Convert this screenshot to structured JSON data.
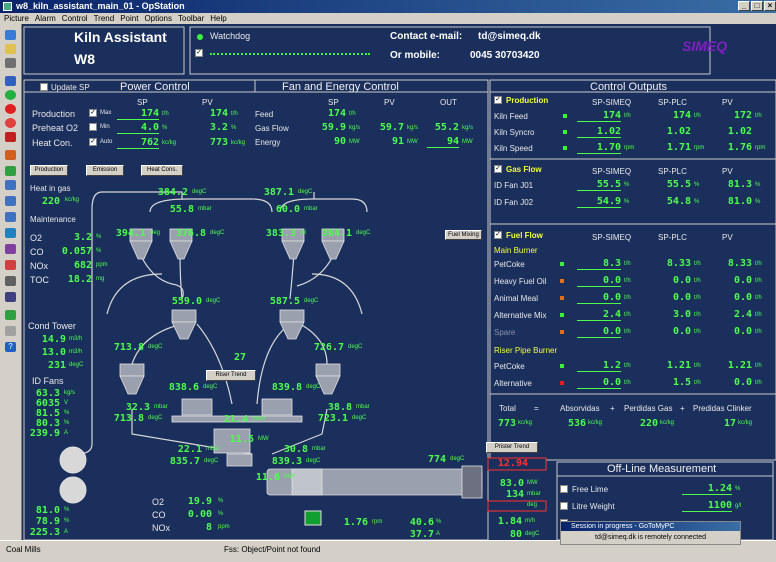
{
  "window": {
    "title": "w8_kiln_assistant_main_01 - OpStation"
  },
  "menu": [
    "Picture",
    "Alarm",
    "Control",
    "Trend",
    "Point",
    "Options",
    "Toolbar",
    "Help"
  ],
  "header": {
    "app_title": "Kiln Assistant",
    "unit": "W8",
    "watchdog_label": "Watchdog",
    "contact_email_label": "Contact e-mail:",
    "contact_email": "td@simeq.dk",
    "mobile_label": "Or mobile:",
    "mobile": "0045 30703420",
    "brand": "SIMEQ"
  },
  "power_control": {
    "title": "Power Control",
    "update_sp": "Update SP",
    "col_sp": "SP",
    "col_pv": "PV",
    "rows": [
      {
        "label": "Production",
        "mode": "Max",
        "sp": "174",
        "pv": "174",
        "unit": "t/h"
      },
      {
        "label": "Preheat O2",
        "mode": "Min",
        "sp": "4.0",
        "pv": "3.2",
        "unit": "%"
      },
      {
        "label": "Heat Con.",
        "mode": "Auto",
        "sp": "762",
        "pv": "773",
        "unit": "kc/kg"
      }
    ],
    "buttons": [
      "Production",
      "Emission",
      "Heat Cons."
    ]
  },
  "fan_energy": {
    "title": "Fan and Energy Control",
    "col_sp": "SP",
    "col_pv": "PV",
    "col_out": "OUT",
    "rows": [
      {
        "label": "Feed",
        "sp": "174",
        "pv": "",
        "out": "",
        "unit": "t/h"
      },
      {
        "label": "Gas Flow",
        "sp": "59.9",
        "pv": "59.7",
        "out": "55.2",
        "unit": "kg/s"
      },
      {
        "label": "Energy",
        "sp": "90",
        "pv": "91",
        "out": "94",
        "unit": "MW"
      }
    ]
  },
  "control_outputs": {
    "title": "Control Outputs",
    "production": {
      "title": "Production",
      "cols": [
        "SP-SIMEQ",
        "SP-PLC",
        "PV"
      ],
      "rows": [
        {
          "label": "Kiln Feed",
          "simeq": "174",
          "plc": "174",
          "pv": "172",
          "unit": "t/h"
        },
        {
          "label": "Kiln Syncro",
          "simeq": "1.02",
          "plc": "1.02",
          "pv": "1.02",
          "unit": ""
        },
        {
          "label": "Kiln Speed",
          "simeq": "1.70",
          "plc": "1.71",
          "pv": "1.76",
          "unit": "rpm"
        }
      ]
    },
    "gas_flow": {
      "title": "Gas Flow",
      "cols": [
        "SP-SIMEQ",
        "SP-PLC",
        "PV"
      ],
      "rows": [
        {
          "label": "ID Fan J01",
          "simeq": "55.5",
          "plc": "55.5",
          "pv": "81.3",
          "unit": "%"
        },
        {
          "label": "ID Fan J02",
          "simeq": "54.9",
          "plc": "54.8",
          "pv": "81.0",
          "unit": "%"
        }
      ]
    },
    "fuel_flow": {
      "title": "Fuel Flow",
      "cols": [
        "SP-SIMEQ",
        "SP-PLC",
        "PV"
      ],
      "main_burner": "Main Burner",
      "riser": "Riser Pipe Burner",
      "rows": [
        {
          "label": "PetCoke",
          "simeq": "8.3",
          "plc": "8.33",
          "pv": "8.33",
          "unit": "t/h"
        },
        {
          "label": "Heavy Fuel Oil",
          "simeq": "0.0",
          "plc": "0.0",
          "pv": "0.0",
          "unit": "t/h"
        },
        {
          "label": "Animal Meal",
          "simeq": "0.0",
          "plc": "0.0",
          "pv": "0.0",
          "unit": "t/h"
        },
        {
          "label": "Alternative Mix",
          "simeq": "2.4",
          "plc": "3.0",
          "pv": "2.4",
          "unit": "t/h"
        },
        {
          "label": "Spare",
          "simeq": "0.0",
          "plc": "0.0",
          "pv": "0.0",
          "unit": "t/h"
        },
        {
          "label": "PetCoke",
          "simeq": "1.2",
          "plc": "1.21",
          "pv": "1.21",
          "unit": "t/h"
        },
        {
          "label": "Alternative",
          "simeq": "0.0",
          "plc": "1.5",
          "pv": "0.0",
          "unit": "t/h"
        }
      ]
    },
    "totals": {
      "total_label": "Total",
      "eq": "=",
      "plus1": "+",
      "plus2": "+",
      "absorbed_label": "Absorvidas",
      "gas_loss_label": "Perdidas Gas",
      "clinker_loss_label": "Predidas Clinker",
      "total": "773",
      "absorbed": "536",
      "gas_loss": "220",
      "clinker_loss": "17",
      "unit": "kc/kg"
    }
  },
  "offline": {
    "title": "Off-Line Measurement",
    "rows": [
      {
        "label": "Free Lime",
        "value": "1.24",
        "unit": "%"
      },
      {
        "label": "Litre Weight",
        "value": "1100",
        "unit": "g/l"
      },
      {
        "label": "",
        "value": "",
        "unit": ""
      }
    ]
  },
  "process": {
    "heat_in_gas_label": "Heat in gas",
    "heat_in_gas": "220",
    "heat_in_gas_unit": "kc/kg",
    "maintenance_label": "Maintenance",
    "gases": [
      {
        "label": "O2",
        "value": "3.2",
        "unit": "%"
      },
      {
        "label": "CO",
        "value": "0.057",
        "unit": "%"
      },
      {
        "label": "NOx",
        "value": "682",
        "unit": "ppm"
      },
      {
        "label": "TOC",
        "value": "18.2",
        "unit": "mg"
      }
    ],
    "cond_tower_label": "Cond Tower",
    "cond_tower": [
      {
        "value": "14.9",
        "unit": "m3/h"
      },
      {
        "value": "13.0",
        "unit": "m3/h"
      },
      {
        "value": "231",
        "unit": "degC"
      }
    ],
    "id_fans_label": "ID Fans",
    "id_fans": [
      {
        "value": "63.3",
        "unit": "kg/s"
      },
      {
        "value": "6035",
        "unit": "V"
      },
      {
        "value": "81.5",
        "unit": "%"
      },
      {
        "value": "80.3",
        "unit": "%"
      },
      {
        "value": "239.9",
        "unit": "A"
      }
    ],
    "bottom_left": [
      {
        "value": "81.0",
        "unit": "%"
      },
      {
        "value": "78.9",
        "unit": "%"
      },
      {
        "value": "225.3",
        "unit": "A"
      }
    ],
    "tower": {
      "top1": "384.2",
      "top1u": "degC",
      "top2": "387.1",
      "top2u": "degC",
      "p1": "55.8",
      "p1u": "mbar",
      "p2": "60.0",
      "p2u": "mbar",
      "c1": "394.1",
      "c1u": "deg",
      "c2": "376.8",
      "c2u": "degC",
      "c3": "383.3",
      "c3u": "dk",
      "c4": "384.1",
      "c4u": "degC",
      "m1": "559.0",
      "m1u": "degC",
      "m2": "587.5",
      "m2u": "degC",
      "l1": "713.8",
      "l1u": "degC",
      "l2": "726.7",
      "l2u": "degC",
      "num27": "27",
      "b1": "838.6",
      "b1u": "degC",
      "b2": "839.8",
      "b2u": "degC",
      "lp1": "32.3",
      "lp1u": "mbar",
      "lt1": "713.8",
      "lt1u": "degC",
      "lp2": "38.8",
      "lp2u": "mbar",
      "lt2": "723.1",
      "lt2u": "degC",
      "mid": "21.4",
      "midu": "mbar",
      "bp1": "22.1",
      "bp1u": "mbar",
      "bt1": "835.7",
      "bt1u": "degC",
      "bp2": "30.8",
      "bp2u": "mbar",
      "bt2": "839.3",
      "bt2u": "degC",
      "mw": "11.5",
      "mwu": "MW",
      "calc": "11.6",
      "calcu": "MW"
    },
    "fuel_mixing": "Fuel Mixing",
    "riser_trend": "Riser Trend",
    "prister_trend": "Prister Trend",
    "kiln_inlet": "774",
    "kiln_inlet_u": "degC",
    "alarm_val": "12.94",
    "kiln_vals": [
      {
        "value": "83.0",
        "unit": "MW"
      },
      {
        "value": "134",
        "unit": "mbar"
      },
      {
        "value": "",
        "unit": "deg"
      }
    ],
    "bottom_gases": [
      {
        "label": "O2",
        "value": "19.9",
        "unit": "%"
      },
      {
        "label": "CO",
        "value": "0.00",
        "unit": "%"
      },
      {
        "label": "NOx",
        "value": "8",
        "unit": "ppm"
      }
    ],
    "kiln_speed": "1.76",
    "kiln_speed_u": "rpm",
    "bot1": "40.6",
    "bot1u": "%",
    "bot2": "37.7",
    "bot2u": "A",
    "bot3": "1.84",
    "bot3u": "m/h",
    "bot4": "80",
    "bot4u": "degC"
  },
  "statusbar": {
    "left": "Coal Mills",
    "mid": "Fss: Object/Point not found"
  },
  "popup": {
    "title": "Session in progress - GoToMyPC",
    "text": "td@simeq.dk is remotely connected"
  },
  "colors": {
    "bg": "#1b2f5d",
    "value": "#4cff4c",
    "section": "#f2ff30",
    "alarm": "#ff3030"
  }
}
